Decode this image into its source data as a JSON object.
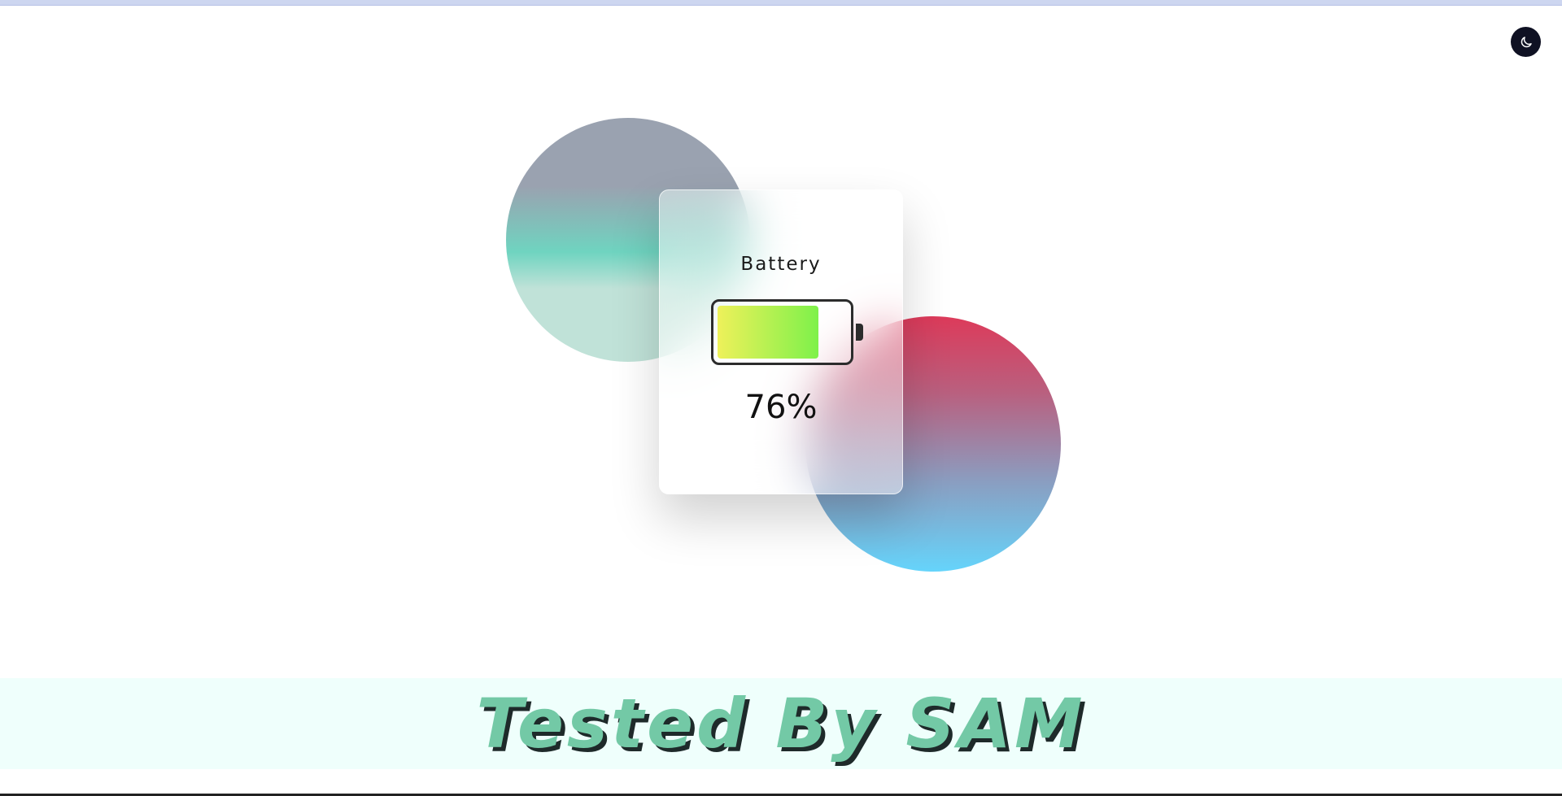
{
  "header": {
    "theme_toggle_icon": "moon-icon"
  },
  "card": {
    "title": "Battery",
    "battery_level_percent": 76,
    "battery_level_label": "76%"
  },
  "footer": {
    "text": "Tested By SAM"
  },
  "colors": {
    "theme_toggle_bg": "#0f1123",
    "battery_fill_start": "#eef15a",
    "battery_fill_end": "#7ef14a",
    "footer_text": "#73c9a6",
    "footer_band_bg": "#effffc",
    "left_circle_top": "#9aa2b0",
    "left_circle_mid": "#6fd4c0",
    "right_circle_top": "#dd3a5a",
    "right_circle_bottom": "#65d4fb"
  }
}
